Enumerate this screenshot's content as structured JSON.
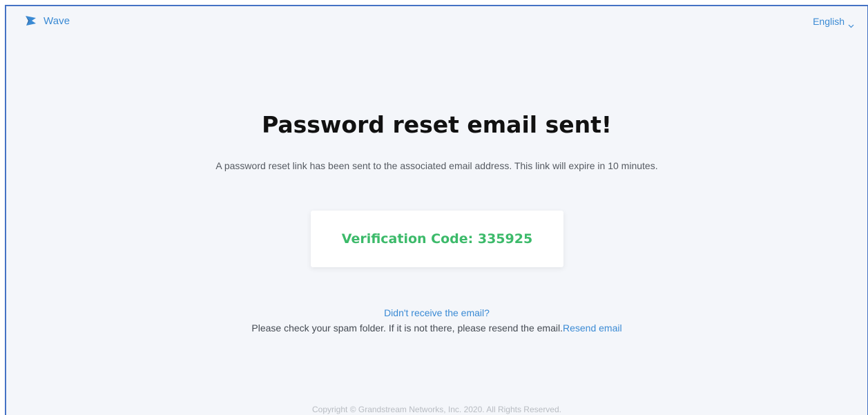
{
  "header": {
    "brand": "Wave",
    "brand_icon": "wave-logo-icon",
    "language": "English",
    "language_icon": "chevron-down-icon"
  },
  "main": {
    "title": "Password reset email sent!",
    "description": "A password reset link has been sent to the associated email address. This link will expire in 10 minutes.",
    "verification_label": "Verification Code: 335925",
    "help_link": "Didn't receive the email?",
    "help_text": "Please check your spam folder. If it is not there, please resend the email.",
    "resend_link": "Resend email"
  },
  "footer": {
    "copyright": "Copyright © Grandstream Networks, Inc. 2020. All Rights Reserved."
  },
  "colors": {
    "accent": "#3a8ad4",
    "success": "#3cba6a",
    "background": "#f4f6fa",
    "frame_border": "#4472c4"
  }
}
